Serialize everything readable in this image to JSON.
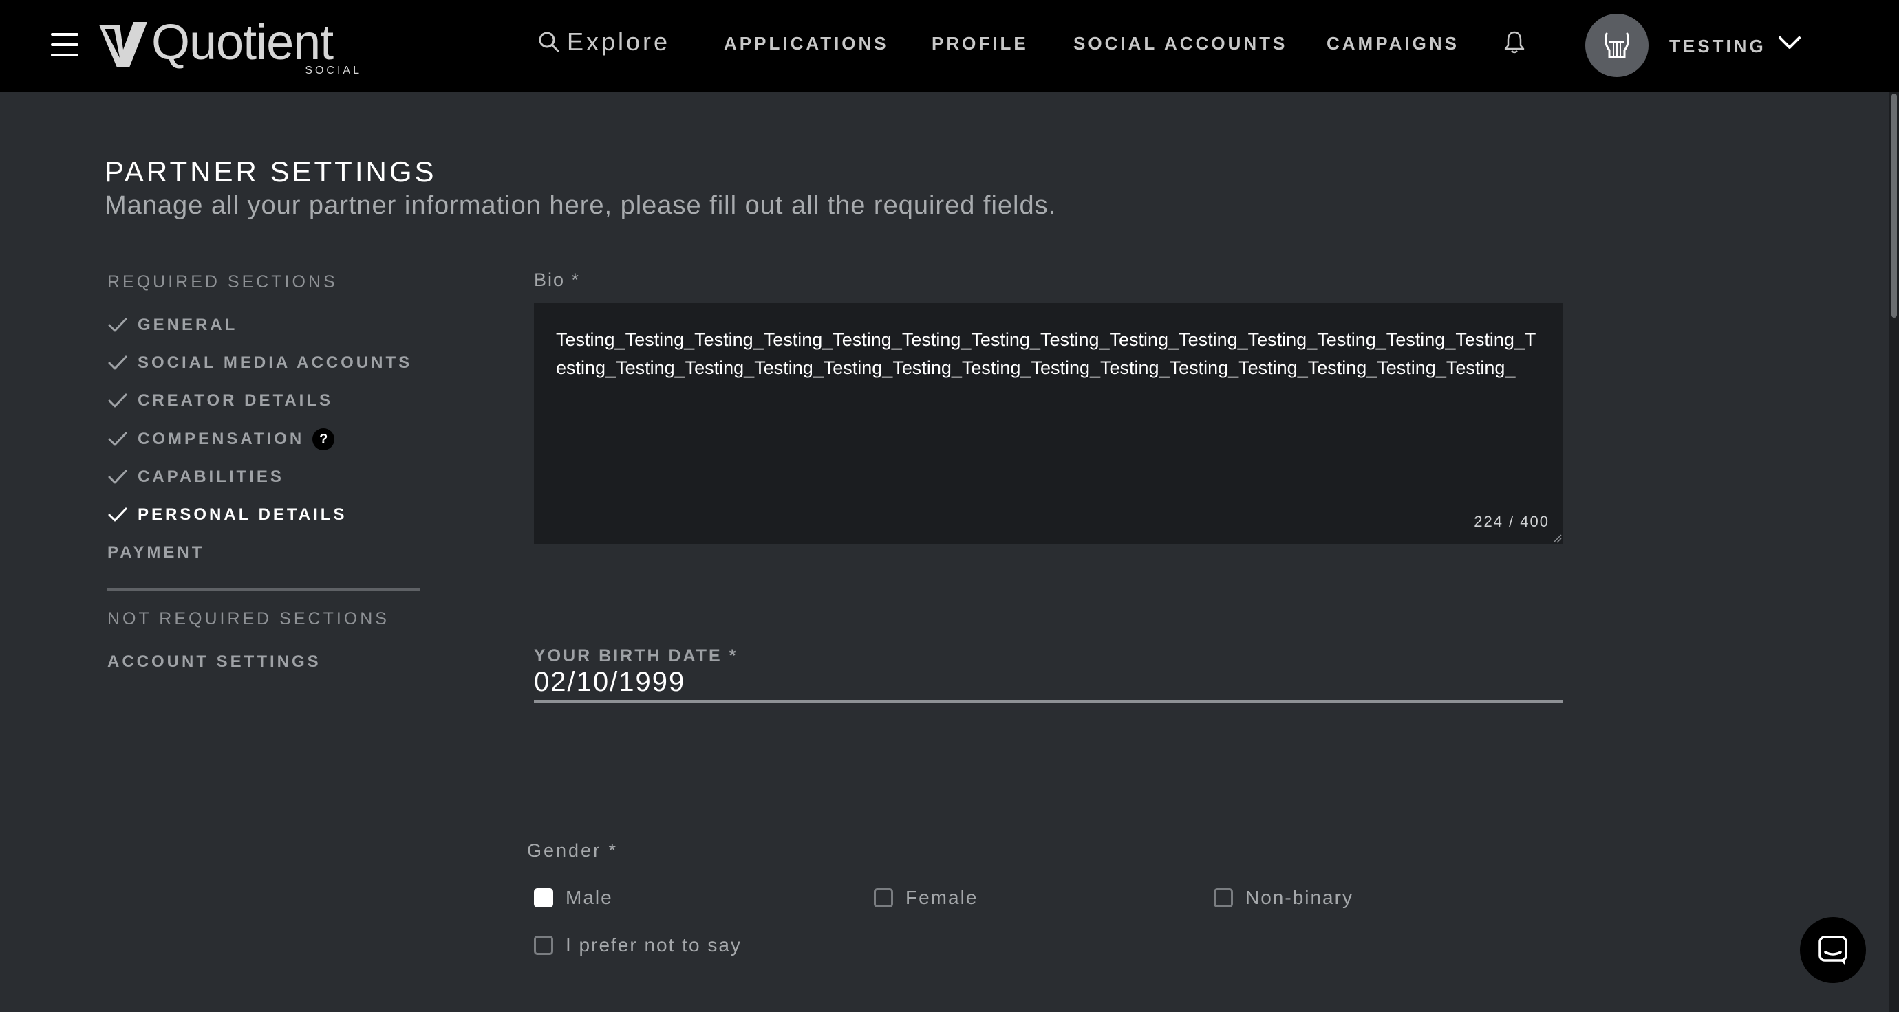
{
  "nav": {
    "logo_text": "Quotient",
    "logo_sub": "SOCIAL",
    "search_label": "Explore",
    "links": [
      "APPLICATIONS",
      "PROFILE",
      "SOCIAL ACCOUNTS",
      "CAMPAIGNS"
    ],
    "user_name": "TESTING"
  },
  "page": {
    "title": "PARTNER SETTINGS",
    "subtitle": "Manage all your partner information here, please fill out all the required fields."
  },
  "sidebar": {
    "required_heading": "REQUIRED SECTIONS",
    "required_items": [
      {
        "label": "GENERAL",
        "checked": true
      },
      {
        "label": "SOCIAL MEDIA ACCOUNTS",
        "checked": true
      },
      {
        "label": "CREATOR DETAILS",
        "checked": true
      },
      {
        "label": "COMPENSATION",
        "checked": true,
        "help": "?"
      },
      {
        "label": "CAPABILITIES",
        "checked": true
      },
      {
        "label": "PERSONAL DETAILS",
        "checked": true,
        "active": true
      },
      {
        "label": "PAYMENT",
        "checked": false
      }
    ],
    "optional_heading": "NOT REQUIRED SECTIONS",
    "optional_items": [
      {
        "label": "ACCOUNT SETTINGS"
      }
    ]
  },
  "form": {
    "bio_label": "Bio *",
    "bio_value": "Testing_Testing_Testing_Testing_Testing_Testing_Testing_Testing_Testing_Testing_Testing_Testing_Testing_Testing_Testing_Testing_Testing_Testing_Testing_Testing_Testing_Testing_Testing_Testing_Testing_Testing_Testing_Testing_",
    "bio_counter": "224 / 400",
    "birth_label": "YOUR BIRTH DATE *",
    "birth_value": "02/10/1999",
    "gender_label": "Gender *",
    "gender_options": [
      {
        "label": "Male",
        "checked": true
      },
      {
        "label": "Female",
        "checked": false
      },
      {
        "label": "Non-binary",
        "checked": false
      },
      {
        "label": "I prefer not to say",
        "checked": false
      }
    ]
  },
  "colors": {
    "background": "#2a2d31",
    "topbar": "#000000",
    "textarea_bg": "#1b1d20"
  },
  "icons": [
    "hamburger-icon",
    "search-icon",
    "bell-icon",
    "lyre-icon",
    "chevron-down-icon",
    "check-icon",
    "chat-icon"
  ]
}
